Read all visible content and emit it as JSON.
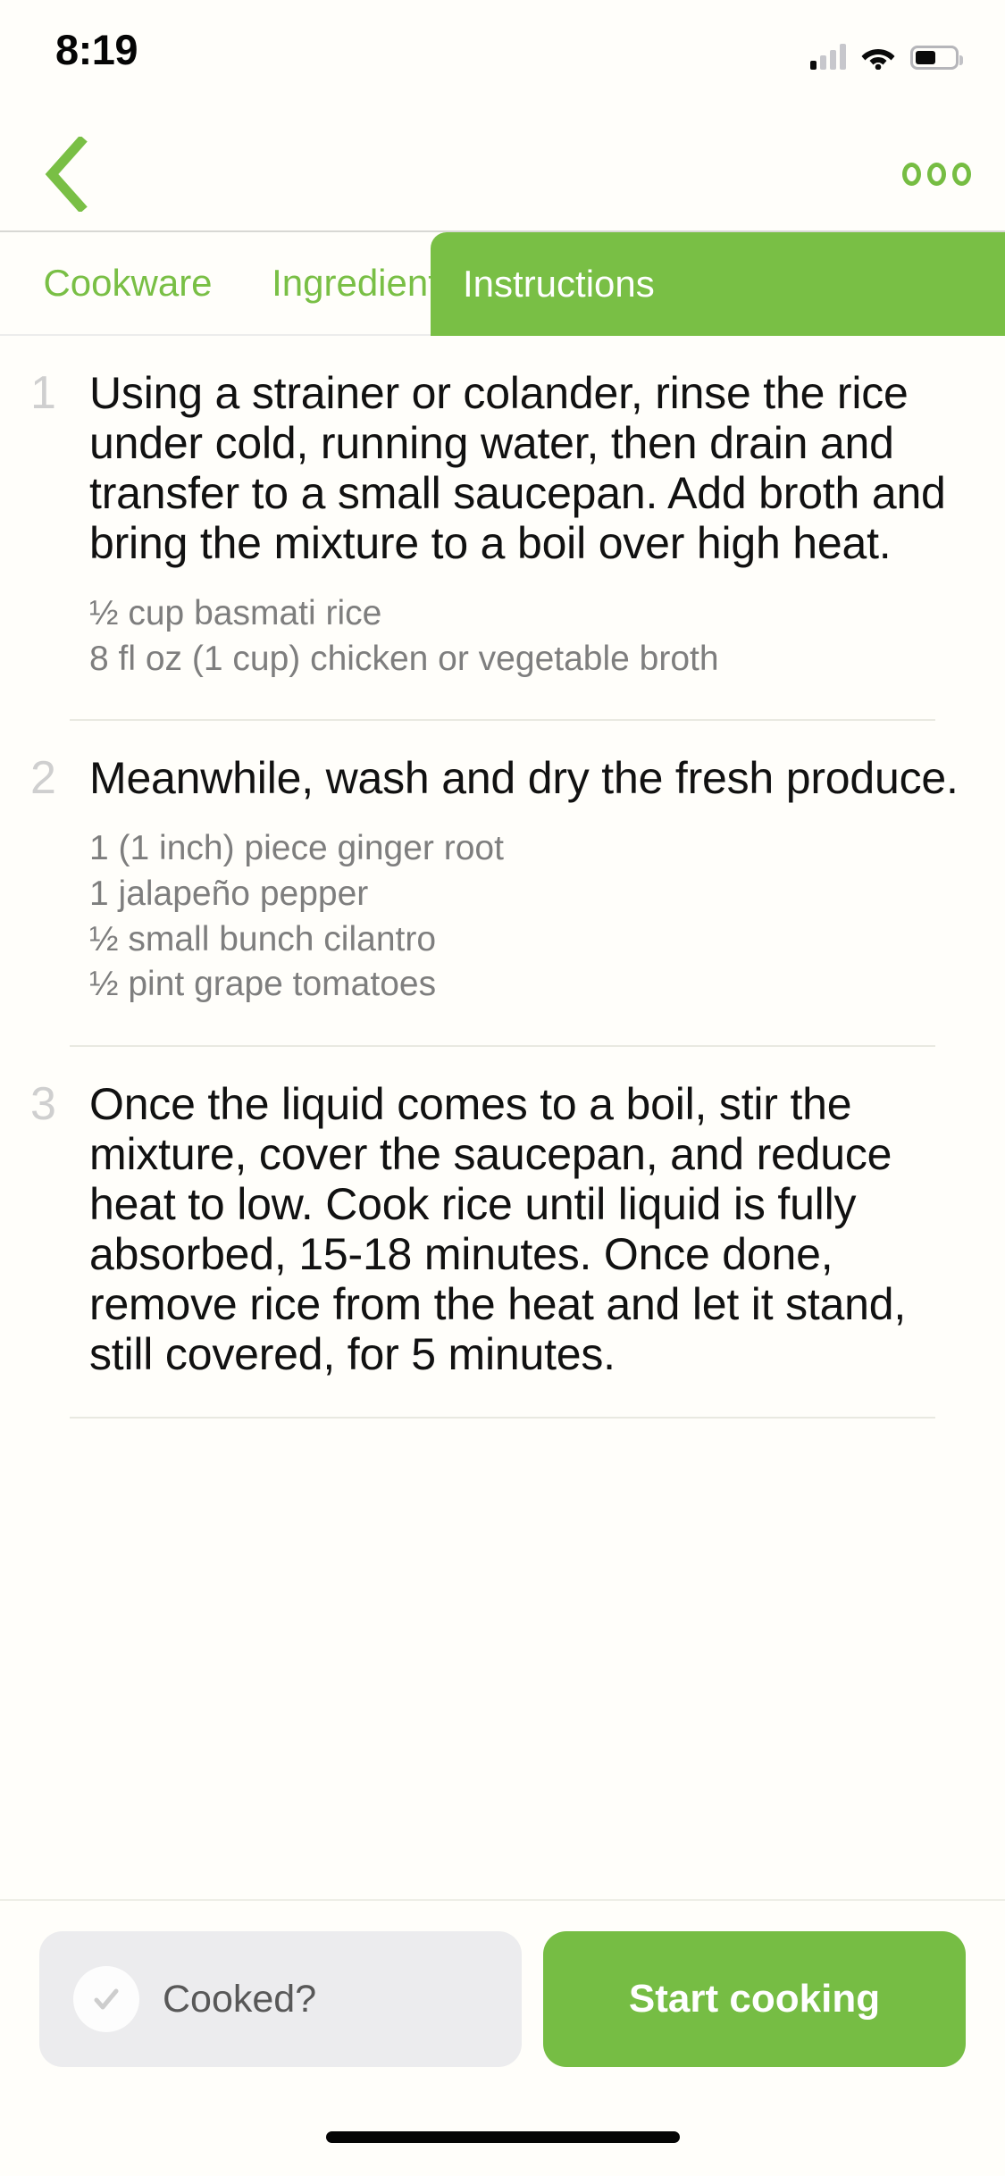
{
  "status_bar": {
    "time": "8:19",
    "signal_icon": "cellular-signal-icon",
    "wifi_icon": "wifi-icon",
    "battery_icon": "battery-icon",
    "battery_level_pct": 52
  },
  "nav_bar": {
    "back_icon": "chevron-left-icon",
    "more_icon": "more-options-icon"
  },
  "tabs": [
    {
      "label": "Cookware",
      "active": false
    },
    {
      "label": "Ingredients",
      "active": false
    },
    {
      "label": "Instructions",
      "active": true
    }
  ],
  "steps": [
    {
      "number": "1",
      "text": "Using a strainer or colander, rinse the rice under cold, running water, then drain and transfer to a small saucepan. Add broth and bring the mixture to a boil over high heat.",
      "ingredients": [
        "½ cup basmati rice",
        "8 fl oz (1 cup) chicken or vegetable broth"
      ]
    },
    {
      "number": "2",
      "text": "Meanwhile, wash and dry the fresh produce.",
      "ingredients": [
        "1 (1 inch) piece ginger root",
        "1 jalapeño pepper",
        "½ small bunch cilantro",
        "½ pint grape tomatoes"
      ]
    },
    {
      "number": "3",
      "text": "Once the liquid comes to a boil, stir the mixture, cover the saucepan, and reduce heat to low. Cook rice until liquid is fully absorbed, 15-18 minutes. Once done, remove rice from the heat and let it stand, still covered, for 5 minutes.",
      "ingredients": []
    }
  ],
  "bottom_bar": {
    "cooked_label": "Cooked?",
    "cooked_icon": "check-circle-icon",
    "cooked_checked": false,
    "start_label": "Start cooking"
  },
  "colors": {
    "accent_green": "#79bf45",
    "button_green": "#76bd44",
    "page_background": "#fffefa",
    "step_number_gray": "#cfcfcf",
    "ingredient_gray": "#7e7e7e",
    "cooked_pill_gray": "#ececee"
  }
}
